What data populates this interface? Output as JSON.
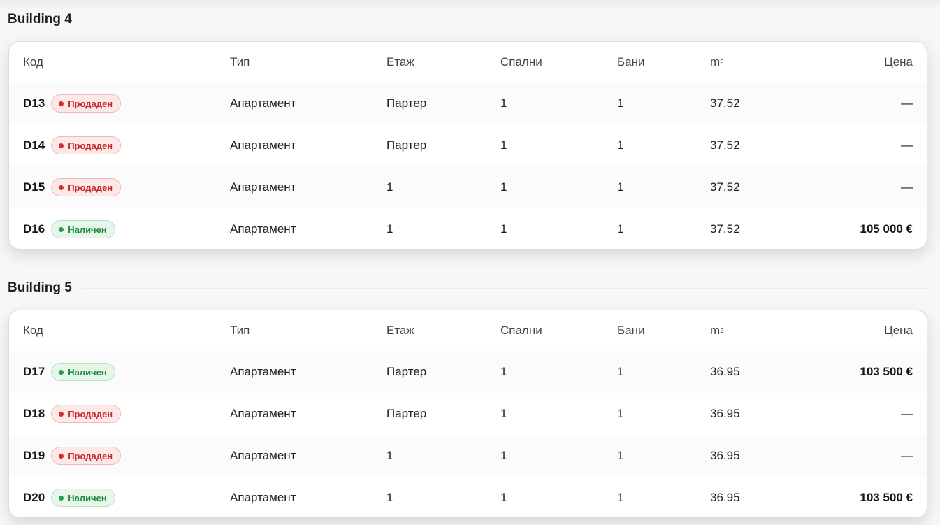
{
  "columns": {
    "code": "Код",
    "type": "Тип",
    "floor": "Етаж",
    "bedrooms": "Спални",
    "bathrooms": "Бани",
    "area_base": "m",
    "area_sup": "2",
    "price": "Цена"
  },
  "status_colors": {
    "sold_bg": "#fde8e8",
    "sold_text": "#c62828",
    "available_bg": "#e6f6ea",
    "available_text": "#1e8a3c"
  },
  "sections": [
    {
      "title": "Building 4",
      "rows": [
        {
          "code": "D13",
          "status": "Продаден",
          "status_kind": "sold",
          "type": "Апартамент",
          "floor": "Партер",
          "bedrooms": "1",
          "bathrooms": "1",
          "area": "37.52",
          "price": "—"
        },
        {
          "code": "D14",
          "status": "Продаден",
          "status_kind": "sold",
          "type": "Апартамент",
          "floor": "Партер",
          "bedrooms": "1",
          "bathrooms": "1",
          "area": "37.52",
          "price": "—"
        },
        {
          "code": "D15",
          "status": "Продаден",
          "status_kind": "sold",
          "type": "Апартамент",
          "floor": "1",
          "bedrooms": "1",
          "bathrooms": "1",
          "area": "37.52",
          "price": "—"
        },
        {
          "code": "D16",
          "status": "Наличен",
          "status_kind": "available",
          "type": "Апартамент",
          "floor": "1",
          "bedrooms": "1",
          "bathrooms": "1",
          "area": "37.52",
          "price": "105 000 €"
        }
      ]
    },
    {
      "title": "Building 5",
      "rows": [
        {
          "code": "D17",
          "status": "Наличен",
          "status_kind": "available",
          "type": "Апартамент",
          "floor": "Партер",
          "bedrooms": "1",
          "bathrooms": "1",
          "area": "36.95",
          "price": "103 500 €"
        },
        {
          "code": "D18",
          "status": "Продаден",
          "status_kind": "sold",
          "type": "Апартамент",
          "floor": "Партер",
          "bedrooms": "1",
          "bathrooms": "1",
          "area": "36.95",
          "price": "—"
        },
        {
          "code": "D19",
          "status": "Продаден",
          "status_kind": "sold",
          "type": "Апартамент",
          "floor": "1",
          "bedrooms": "1",
          "bathrooms": "1",
          "area": "36.95",
          "price": "—"
        },
        {
          "code": "D20",
          "status": "Наличен",
          "status_kind": "available",
          "type": "Апартамент",
          "floor": "1",
          "bedrooms": "1",
          "bathrooms": "1",
          "area": "36.95",
          "price": "103 500 €"
        }
      ]
    }
  ]
}
